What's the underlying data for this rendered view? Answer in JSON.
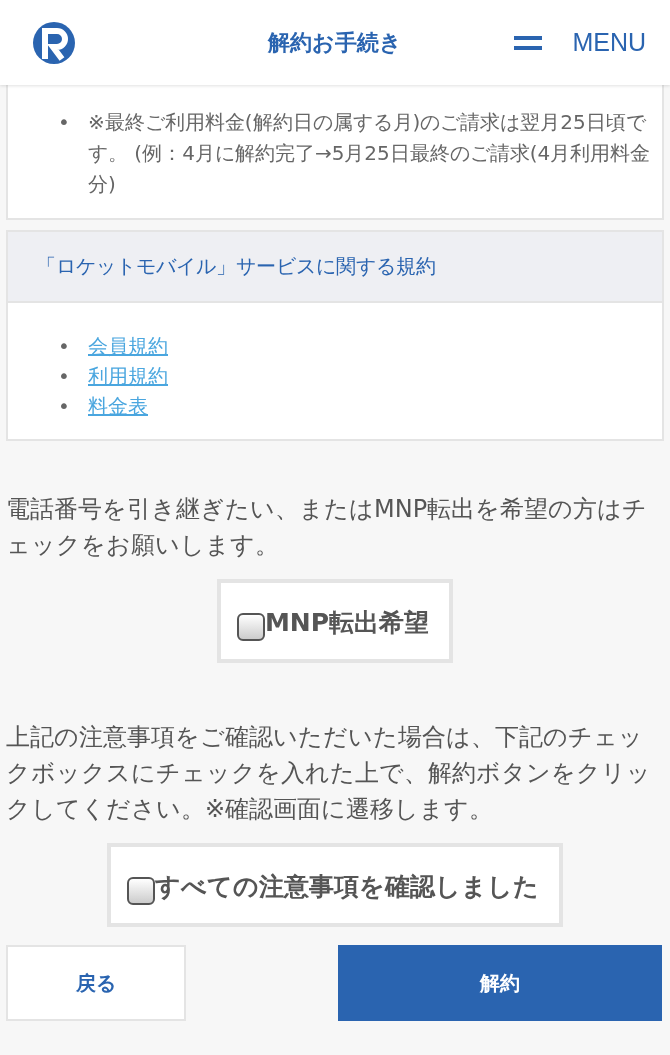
{
  "header": {
    "title": "解約お手続き",
    "menu_label": "MENU"
  },
  "bullet": "•",
  "notes": [
    "※最終ご利用料金(解約日の属する月)のご請求は翌月25日頃です。 (例：4月に解約完了→5月25日最終のご請求(4月利用料金分)"
  ],
  "terms": {
    "heading": "「ロケットモバイル」サービスに関する規約",
    "links": [
      "会員規約",
      "利用規約",
      "料金表"
    ]
  },
  "mnp": {
    "text": "電話番号を引き継ぎたい、またはMNP転出を希望の方はチェックをお願いします。",
    "label": "MNP転出希望",
    "checked": false
  },
  "confirm": {
    "text": "上記の注意事項をご確認いただいた場合は、下記のチェックボックスにチェックを入れた上で、解約ボタンをクリックしてください。※確認画面に遷移します。",
    "label": "すべての注意事項を確認しました",
    "checked": false
  },
  "buttons": [
    {
      "label": "戻る",
      "kind": "secondary"
    },
    {
      "label": "解約",
      "kind": "primary"
    }
  ]
}
